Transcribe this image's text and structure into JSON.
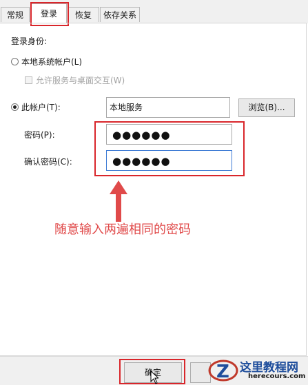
{
  "tabs": [
    {
      "label": "常规"
    },
    {
      "label": "登录"
    },
    {
      "label": "恢复"
    },
    {
      "label": "依存关系"
    }
  ],
  "logon_as_label": "登录身份:",
  "local_system": {
    "label": "本地系统帐户(L)",
    "selected": false,
    "interact_label": "允许服务与桌面交互(W)",
    "interact_checked": false
  },
  "this_account": {
    "label": "此帐户(T):",
    "selected": true,
    "value": "本地服务",
    "browse_label": "浏览(B)..."
  },
  "password": {
    "label": "密码(P):",
    "masked": "●●●●●●"
  },
  "confirm_password": {
    "label": "确认密码(C):",
    "masked": "●●●●●●"
  },
  "annotation": {
    "text": "随意输入两遍相同的密码",
    "color": "#e04a4a"
  },
  "ok_label": "确定",
  "watermark": {
    "title": "这里教程网",
    "url": "herecours.com"
  },
  "accent_red": "#d9262b"
}
